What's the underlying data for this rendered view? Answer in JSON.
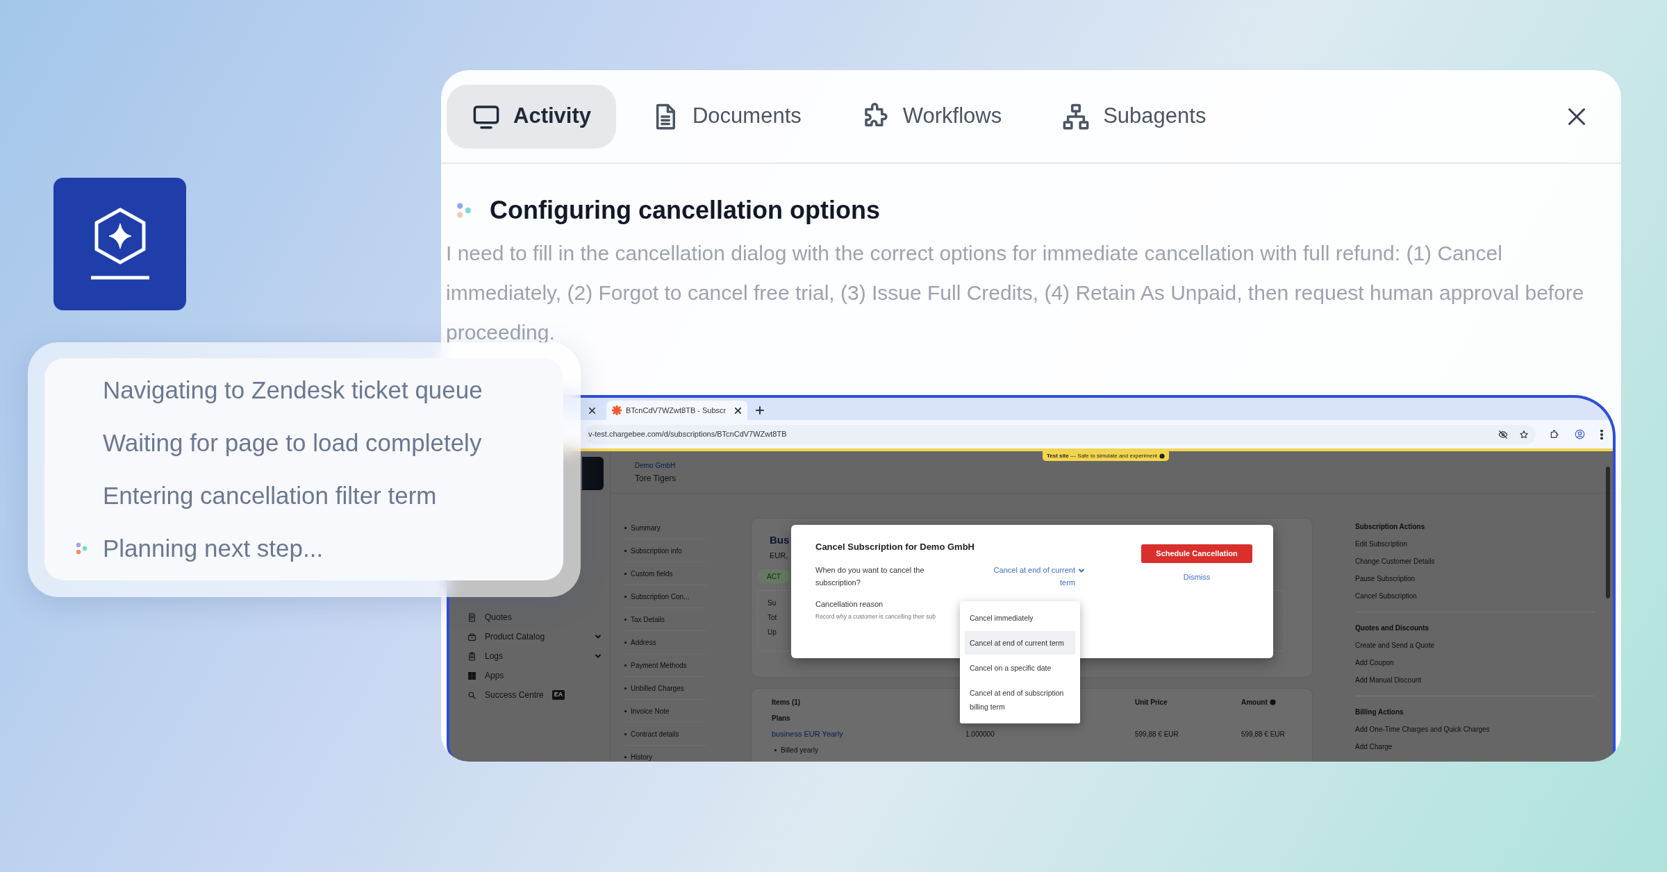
{
  "tabs": [
    {
      "label": "Activity",
      "selected": true
    },
    {
      "label": "Documents",
      "selected": false
    },
    {
      "label": "Workflows",
      "selected": false
    },
    {
      "label": "Subagents",
      "selected": false
    }
  ],
  "step": {
    "title": "Configuring cancellation options",
    "description": "I need to fill in the cancellation dialog with the correct options for immediate cancellation with full refund: (1) Cancel immediately, (2) Forgot to cancel free trial, (3) Issue Full Credits, (4) Retain As Unpaid, then request human approval before proceeding."
  },
  "browser": {
    "tabs": [
      {
        "title": "BTcnCdV7WZwt8TB - Subscr",
        "selected": true
      }
    ],
    "url": "v-test.chargebee.com/d/subscriptions/BTcnCdV7WZwt8TB",
    "test_banner": "**Test site** — Safe to simulate and experiment",
    "sidebar": [
      {
        "label": "Quotes",
        "expandable": false
      },
      {
        "label": "Product Catalog",
        "expandable": true
      },
      {
        "label": "Logs",
        "expandable": true
      },
      {
        "label": "Apps",
        "expandable": false
      },
      {
        "label": "Success Centre",
        "expandable": false,
        "badge": "EA"
      }
    ],
    "account": {
      "company": "Demo GmbH",
      "customer": "Tore Tigers"
    },
    "section_nav": [
      "Summary",
      "Subscription info",
      "Custom fields",
      "Subscription Con...",
      "Tax Details",
      "Address",
      "Payment Methods",
      "Unbilled Charges",
      "Invoice Note",
      "Contract details",
      "History"
    ],
    "subscription_card": {
      "title": "Bus",
      "subtitle": "EUR,",
      "status": "ACT",
      "summary_lines": [
        "Su",
        "Tot",
        "Up"
      ]
    },
    "items_card": {
      "heading": "Items (1)",
      "columns": [
        "Unit Price",
        "Amount"
      ],
      "group": "Plans",
      "plan": {
        "name": "business EUR Yearly",
        "quantity": "1.000000",
        "unit_price": "599,88 € EUR",
        "amount": "599,88 € EUR",
        "note": "Billed yearly"
      }
    },
    "actions": [
      {
        "heading": "Subscription Actions",
        "items": [
          "Edit Subscription",
          "Change Customer Details",
          "Pause Subscription",
          "Cancel Subscription"
        ]
      },
      {
        "heading": "Quotes and Discounts",
        "items": [
          "Create and Send a Quote",
          "Add Coupon",
          "Add Manual Discount"
        ]
      },
      {
        "heading": "Billing Actions",
        "items": [
          "Add One-Time Charges and Quick Charges",
          "Add Charge"
        ]
      }
    ],
    "modal": {
      "title": "Cancel Subscription for Demo GmbH",
      "question": "When do you want to cancel the subscription?",
      "selected_option": "Cancel at end of current term",
      "reason_label": "Cancellation reason",
      "reason_hint": "Record why a customer is cancelling their sub",
      "primary_button": "Schedule Cancellation",
      "dismiss": "Dismiss",
      "options": [
        {
          "label": "Cancel immediately",
          "selected": false
        },
        {
          "label": "Cancel at end of current term",
          "selected": true
        },
        {
          "label": "Cancel on a specific date",
          "selected": false
        },
        {
          "label": "Cancel at end of subscription billing term",
          "selected": false
        }
      ]
    }
  },
  "activity_steps": [
    {
      "label": "Navigating to Zendesk ticket queue",
      "current": false
    },
    {
      "label": "Waiting for page to load completely",
      "current": false
    },
    {
      "label": "Entering cancellation filter term",
      "current": false
    },
    {
      "label": "Planning next step...",
      "current": true
    }
  ]
}
